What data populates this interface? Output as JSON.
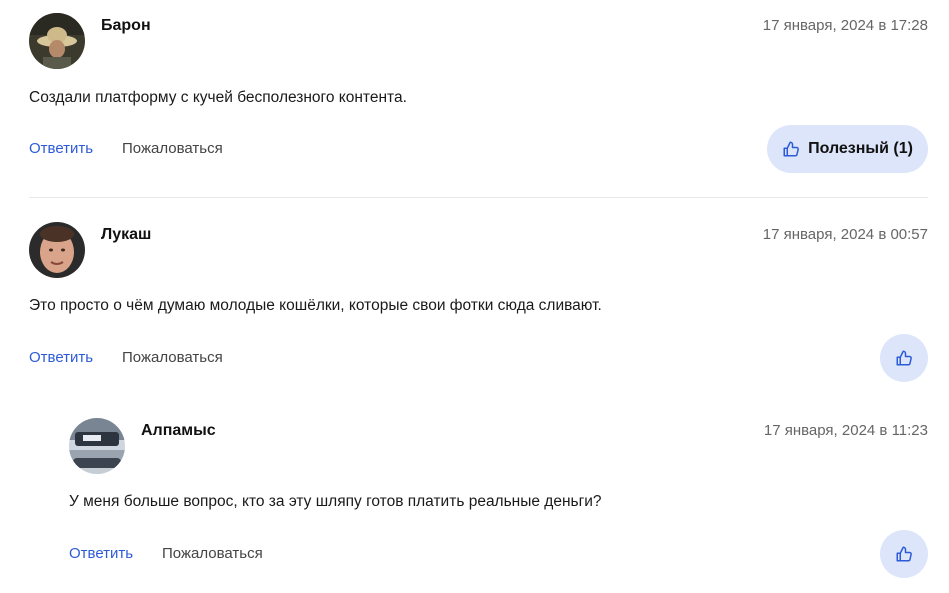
{
  "comments": [
    {
      "author": "Барон",
      "date": "17 января, 2024 в 17:28",
      "text": "Создали платформу с кучей бесполезного контента.",
      "reply_label": "Ответить",
      "report_label": "Пожаловаться",
      "useful_label": "Полезный (1)",
      "avatar_icon": "avatar-man-in-hat"
    },
    {
      "author": "Лукаш",
      "date": "17 января, 2024 в 00:57",
      "text": "Это просто о чём думаю молодые кошёлки, которые свои фотки сюда сливают.",
      "reply_label": "Ответить",
      "report_label": "Пожаловаться",
      "avatar_icon": "avatar-man-face"
    },
    {
      "author": "Алпамыс",
      "date": "17 января, 2024 в 11:23",
      "text": "У меня больше вопрос, кто за эту шляпу готов платить реальные деньги?",
      "reply_label": "Ответить",
      "report_label": "Пожаловаться",
      "avatar_icon": "avatar-car",
      "is_reply": true
    }
  ],
  "colors": {
    "link": "#2d5bd8",
    "useful_bg": "#dde5fb",
    "thumb_icon": "#2d5bd8"
  }
}
